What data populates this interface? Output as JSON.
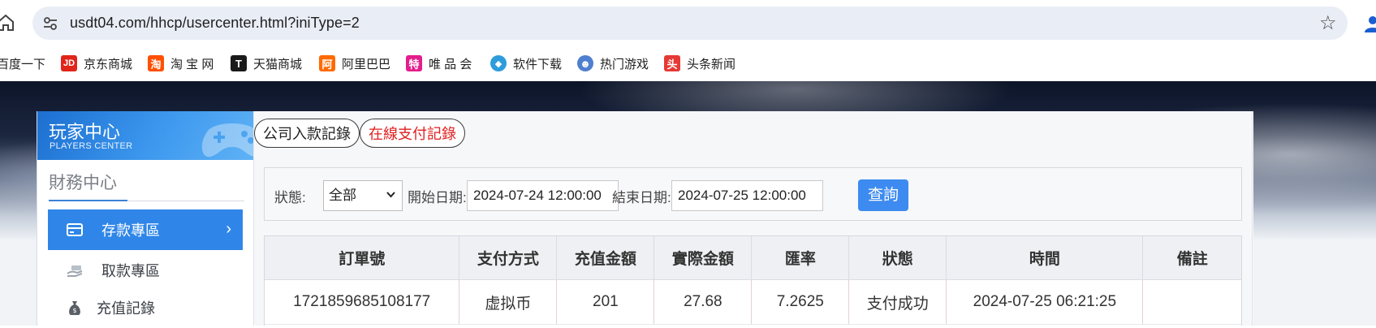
{
  "browser": {
    "url": "usdt04.com/hhcp/usercenter.html?iniType=2",
    "bookmarks": [
      {
        "label": "百度一下",
        "icon": "baidu-icon",
        "color": "#2932e1",
        "glyph": ""
      },
      {
        "label": "京东商城",
        "icon": "jd-icon",
        "color": "#e1251b",
        "glyph": "JD"
      },
      {
        "label": "淘 宝 网",
        "icon": "taobao-icon",
        "color": "#ff5000",
        "glyph": "淘"
      },
      {
        "label": "天猫商城",
        "icon": "tmall-icon",
        "color": "#1a1a1a",
        "glyph": "T"
      },
      {
        "label": "阿里巴巴",
        "icon": "alibaba-icon",
        "color": "#ff6a00",
        "glyph": "阿"
      },
      {
        "label": "唯 品 会",
        "icon": "vip-icon",
        "color": "#e31d8c",
        "glyph": "特"
      },
      {
        "label": "软件下载",
        "icon": "software-icon",
        "color": "#2d9cdb",
        "glyph": "◆"
      },
      {
        "label": "热门游戏",
        "icon": "games-icon",
        "color": "#4f7fcf",
        "glyph": "☻"
      },
      {
        "label": "头条新闻",
        "icon": "toutiao-icon",
        "color": "#e53935",
        "glyph": "头"
      }
    ]
  },
  "sidebar": {
    "title_cn": "玩家中心",
    "title_en": "PLAYERS CENTER",
    "section_title": "財務中心",
    "items": [
      {
        "label": "存款專區",
        "icon": "card-icon",
        "active": true
      },
      {
        "label": "取款專區",
        "icon": "cash-hand-icon",
        "active": false
      },
      {
        "label": "充值記錄",
        "icon": "money-bag-icon",
        "active": false
      }
    ]
  },
  "tabs": [
    {
      "label": "公司入款記錄",
      "color": "#222222"
    },
    {
      "label": "在線支付記錄",
      "color": "#e02020"
    }
  ],
  "filter": {
    "status_label": "狀態:",
    "status_value": "全部",
    "start_label": "開始日期:",
    "start_value": "2024-07-24 12:00:00",
    "end_label": "結束日期:",
    "end_value": "2024-07-25 12:00:00",
    "query_label": "查詢"
  },
  "table": {
    "headers": [
      "訂單號",
      "支付方式",
      "充值金額",
      "實際金額",
      "匯率",
      "狀態",
      "時間",
      "備註"
    ],
    "rows": [
      [
        "1721859685108177",
        "虚拟币",
        "201",
        "27.68",
        "7.2625",
        "支付成功",
        "2024-07-25 06:21:25",
        ""
      ]
    ]
  },
  "colors": {
    "accent": "#2f86e8",
    "query_button": "#3d8bf0",
    "tab_red": "#e02020"
  }
}
